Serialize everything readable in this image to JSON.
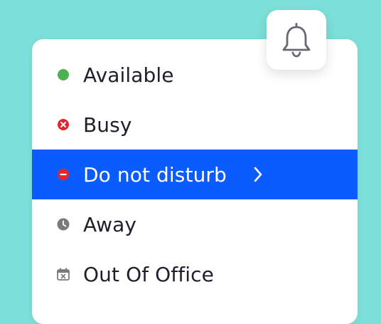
{
  "menu": {
    "items": [
      {
        "label": "Available",
        "icon": "green-dot-icon",
        "color": "#4caf50"
      },
      {
        "label": "Busy",
        "icon": "red-x-circle-icon",
        "color": "#e5242b"
      },
      {
        "label": "Do not disturb",
        "icon": "red-minus-circle-icon",
        "color": "#e5242b",
        "selected": true
      },
      {
        "label": "Away",
        "icon": "clock-icon",
        "color": "#7a7a7a"
      },
      {
        "label": "Out Of Office",
        "icon": "calendar-x-icon",
        "color": "#7a7a7a"
      }
    ]
  },
  "colors": {
    "background": "#7ddfd9",
    "selected": "#0b5cff"
  },
  "icons": {
    "notifications": "bell-icon"
  }
}
